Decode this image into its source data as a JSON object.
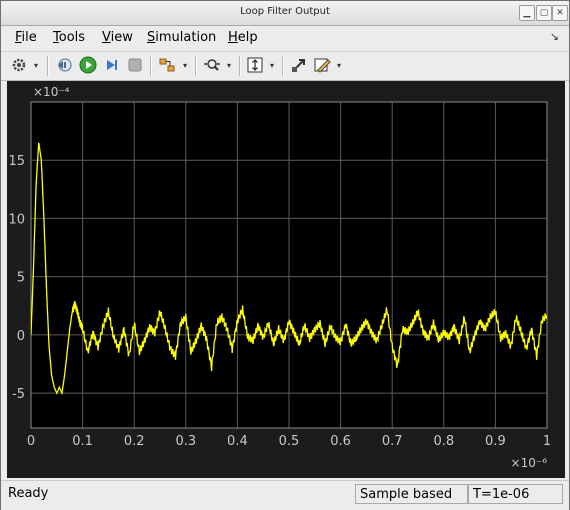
{
  "window": {
    "title": "Loop Filter Output"
  },
  "menu": {
    "items": [
      {
        "label": "File",
        "underline": "F",
        "rest": "ile"
      },
      {
        "label": "Tools",
        "underline": "T",
        "rest": "ools"
      },
      {
        "label": "View",
        "underline": "V",
        "rest": "iew"
      },
      {
        "label": "Simulation",
        "underline": "S",
        "rest": "imulation"
      },
      {
        "label": "Help",
        "underline": "H",
        "rest": "elp"
      }
    ]
  },
  "toolbar": {
    "icons": [
      "gear-icon",
      "step-back-icon",
      "run-icon",
      "step-forward-icon",
      "stop-icon",
      "signal-select-icon",
      "zoom-x-icon",
      "autoscale-icon",
      "highlight-block-icon",
      "style-icon"
    ]
  },
  "statusbar": {
    "status": "Ready",
    "mode": "Sample based",
    "time": "T=1e-06"
  },
  "colors": {
    "plot_background": "#000000",
    "figure_background": "#1c1c1c",
    "grid": "#5a5a5a",
    "trace": "#ffff00",
    "tick_text": "#c8c8c8"
  },
  "chart_data": {
    "type": "line",
    "title": "",
    "xlabel": "",
    "ylabel": "",
    "x_exponent_label": "×10⁻⁶",
    "y_exponent_label": "×10⁻⁴",
    "xlim": [
      0,
      1
    ],
    "ylim": [
      -8,
      20
    ],
    "x_ticks": [
      0,
      0.1,
      0.2,
      0.3,
      0.4,
      0.5,
      0.6,
      0.7,
      0.8,
      0.9,
      1
    ],
    "x_tick_labels": [
      "0",
      "0.1",
      "0.2",
      "0.3",
      "0.4",
      "0.5",
      "0.6",
      "0.7",
      "0.8",
      "0.9",
      "1"
    ],
    "y_ticks": [
      -5,
      0,
      5,
      10,
      15
    ],
    "y_tick_labels": [
      "-5",
      "0",
      "5",
      "10",
      "15"
    ],
    "grid": true,
    "series": [
      {
        "x": [
          0,
          0.005,
          0.01,
          0.015,
          0.02,
          0.025,
          0.03,
          0.035,
          0.04,
          0.045,
          0.05,
          0.055,
          0.06,
          0.065,
          0.07,
          0.075,
          0.08,
          0.085,
          0.09,
          0.095,
          0.1,
          0.11,
          0.12,
          0.13,
          0.14,
          0.15,
          0.16,
          0.17,
          0.18,
          0.19,
          0.2,
          0.21,
          0.22,
          0.23,
          0.24,
          0.25,
          0.26,
          0.27,
          0.28,
          0.29,
          0.3,
          0.31,
          0.32,
          0.33,
          0.34,
          0.35,
          0.36,
          0.37,
          0.38,
          0.39,
          0.4,
          0.41,
          0.42,
          0.43,
          0.44,
          0.45,
          0.46,
          0.47,
          0.48,
          0.49,
          0.5,
          0.51,
          0.52,
          0.53,
          0.54,
          0.55,
          0.56,
          0.57,
          0.58,
          0.59,
          0.6,
          0.61,
          0.62,
          0.63,
          0.64,
          0.65,
          0.66,
          0.67,
          0.68,
          0.69,
          0.7,
          0.71,
          0.72,
          0.73,
          0.74,
          0.75,
          0.76,
          0.77,
          0.78,
          0.79,
          0.8,
          0.81,
          0.82,
          0.83,
          0.84,
          0.85,
          0.86,
          0.87,
          0.88,
          0.89,
          0.9,
          0.91,
          0.92,
          0.93,
          0.94,
          0.95,
          0.96,
          0.97,
          0.98,
          0.99,
          1.0
        ],
        "y": [
          0,
          6,
          13,
          16.5,
          15,
          10,
          4,
          -1,
          -3.5,
          -4.5,
          -5,
          -4.5,
          -5,
          -3.5,
          -1.5,
          0.5,
          2,
          2.7,
          2,
          1,
          0.5,
          -1.5,
          0.2,
          -1,
          0.8,
          2,
          -0.2,
          -1.2,
          0.5,
          -1.8,
          1,
          -1.5,
          -0.5,
          0.7,
          0.2,
          2,
          0.5,
          -1.2,
          -1.8,
          1,
          1.5,
          -1.5,
          -0.5,
          0.8,
          -0.3,
          -2.8,
          1,
          1.5,
          0.5,
          -1.2,
          1.2,
          2.2,
          -0.2,
          -0.5,
          0.8,
          -0.2,
          1,
          -0.8,
          0.5,
          -0.5,
          1.2,
          0.2,
          -0.8,
          0.8,
          -0.3,
          0.5,
          1,
          -0.8,
          0.7,
          -0.2,
          -0.6,
          0.9,
          -0.8,
          -0.3,
          0.5,
          1.2,
          0.2,
          -0.5,
          0.8,
          2.2,
          -1,
          -2.7,
          0.5,
          0.2,
          1,
          2,
          0.3,
          -0.3,
          1,
          -0.5,
          0.2,
          -0.2,
          0.7,
          -0.5,
          1.5,
          -1.5,
          0,
          1.2,
          0.5,
          1.5,
          2,
          -0.3,
          0.2,
          -1,
          1.5,
          0.2,
          -1.2,
          0.5,
          -1.8,
          1.2,
          1.7
        ]
      }
    ]
  }
}
